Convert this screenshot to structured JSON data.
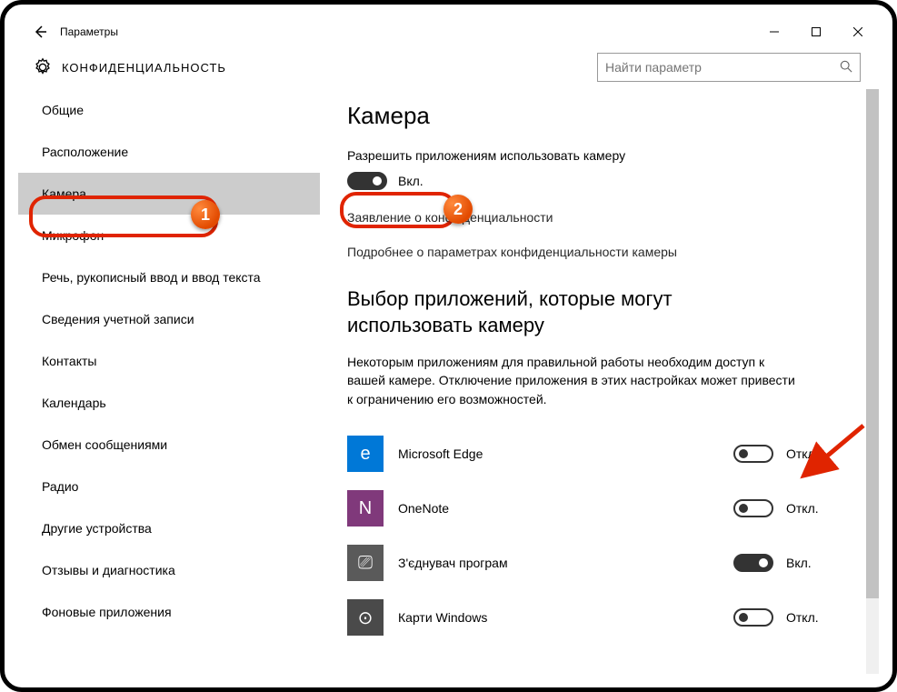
{
  "titlebar": {
    "title": "Параметры"
  },
  "header": {
    "title": "КОНФИДЕНЦИАЛЬНОСТЬ",
    "search_placeholder": "Найти параметр"
  },
  "sidebar": {
    "items": [
      {
        "label": "Общие"
      },
      {
        "label": "Расположение"
      },
      {
        "label": "Камера",
        "selected": true
      },
      {
        "label": "Микрофон"
      },
      {
        "label": "Речь, рукописный ввод и ввод текста"
      },
      {
        "label": "Сведения учетной записи"
      },
      {
        "label": "Контакты"
      },
      {
        "label": "Календарь"
      },
      {
        "label": "Обмен сообщениями"
      },
      {
        "label": "Радио"
      },
      {
        "label": "Другие устройства"
      },
      {
        "label": "Отзывы и диагностика"
      },
      {
        "label": "Фоновые приложения"
      }
    ]
  },
  "main": {
    "page_title": "Камера",
    "allow_caption": "Разрешить приложениям использовать камеру",
    "master_toggle": {
      "on": true,
      "label": "Вкл."
    },
    "link_privacy": "Заявление о конфиденциальности",
    "link_more": "Подробнее о параметрах конфиденциальности камеры",
    "section_title": "Выбор приложений, которые могут использовать камеру",
    "section_desc": "Некоторым приложениям для правильной работы необходим доступ к вашей камере. Отключение приложения в этих настройках может привести к ограничению его возможностей.",
    "apps": [
      {
        "name": "Microsoft Edge",
        "on": false,
        "label": "Откл.",
        "icon_bg": "#0078d7",
        "glyph": "e"
      },
      {
        "name": "OneNote",
        "on": false,
        "label": "Откл.",
        "icon_bg": "#80397b",
        "glyph": "N"
      },
      {
        "name": "З'єднувач програм",
        "on": true,
        "label": "Вкл.",
        "icon_bg": "#5a5a5a",
        "glyph": "⎚"
      },
      {
        "name": "Карти Windows",
        "on": false,
        "label": "Откл.",
        "icon_bg": "#4a4a4a",
        "glyph": "⊙"
      }
    ]
  },
  "annotations": {
    "badge1": "1",
    "badge2": "2"
  }
}
